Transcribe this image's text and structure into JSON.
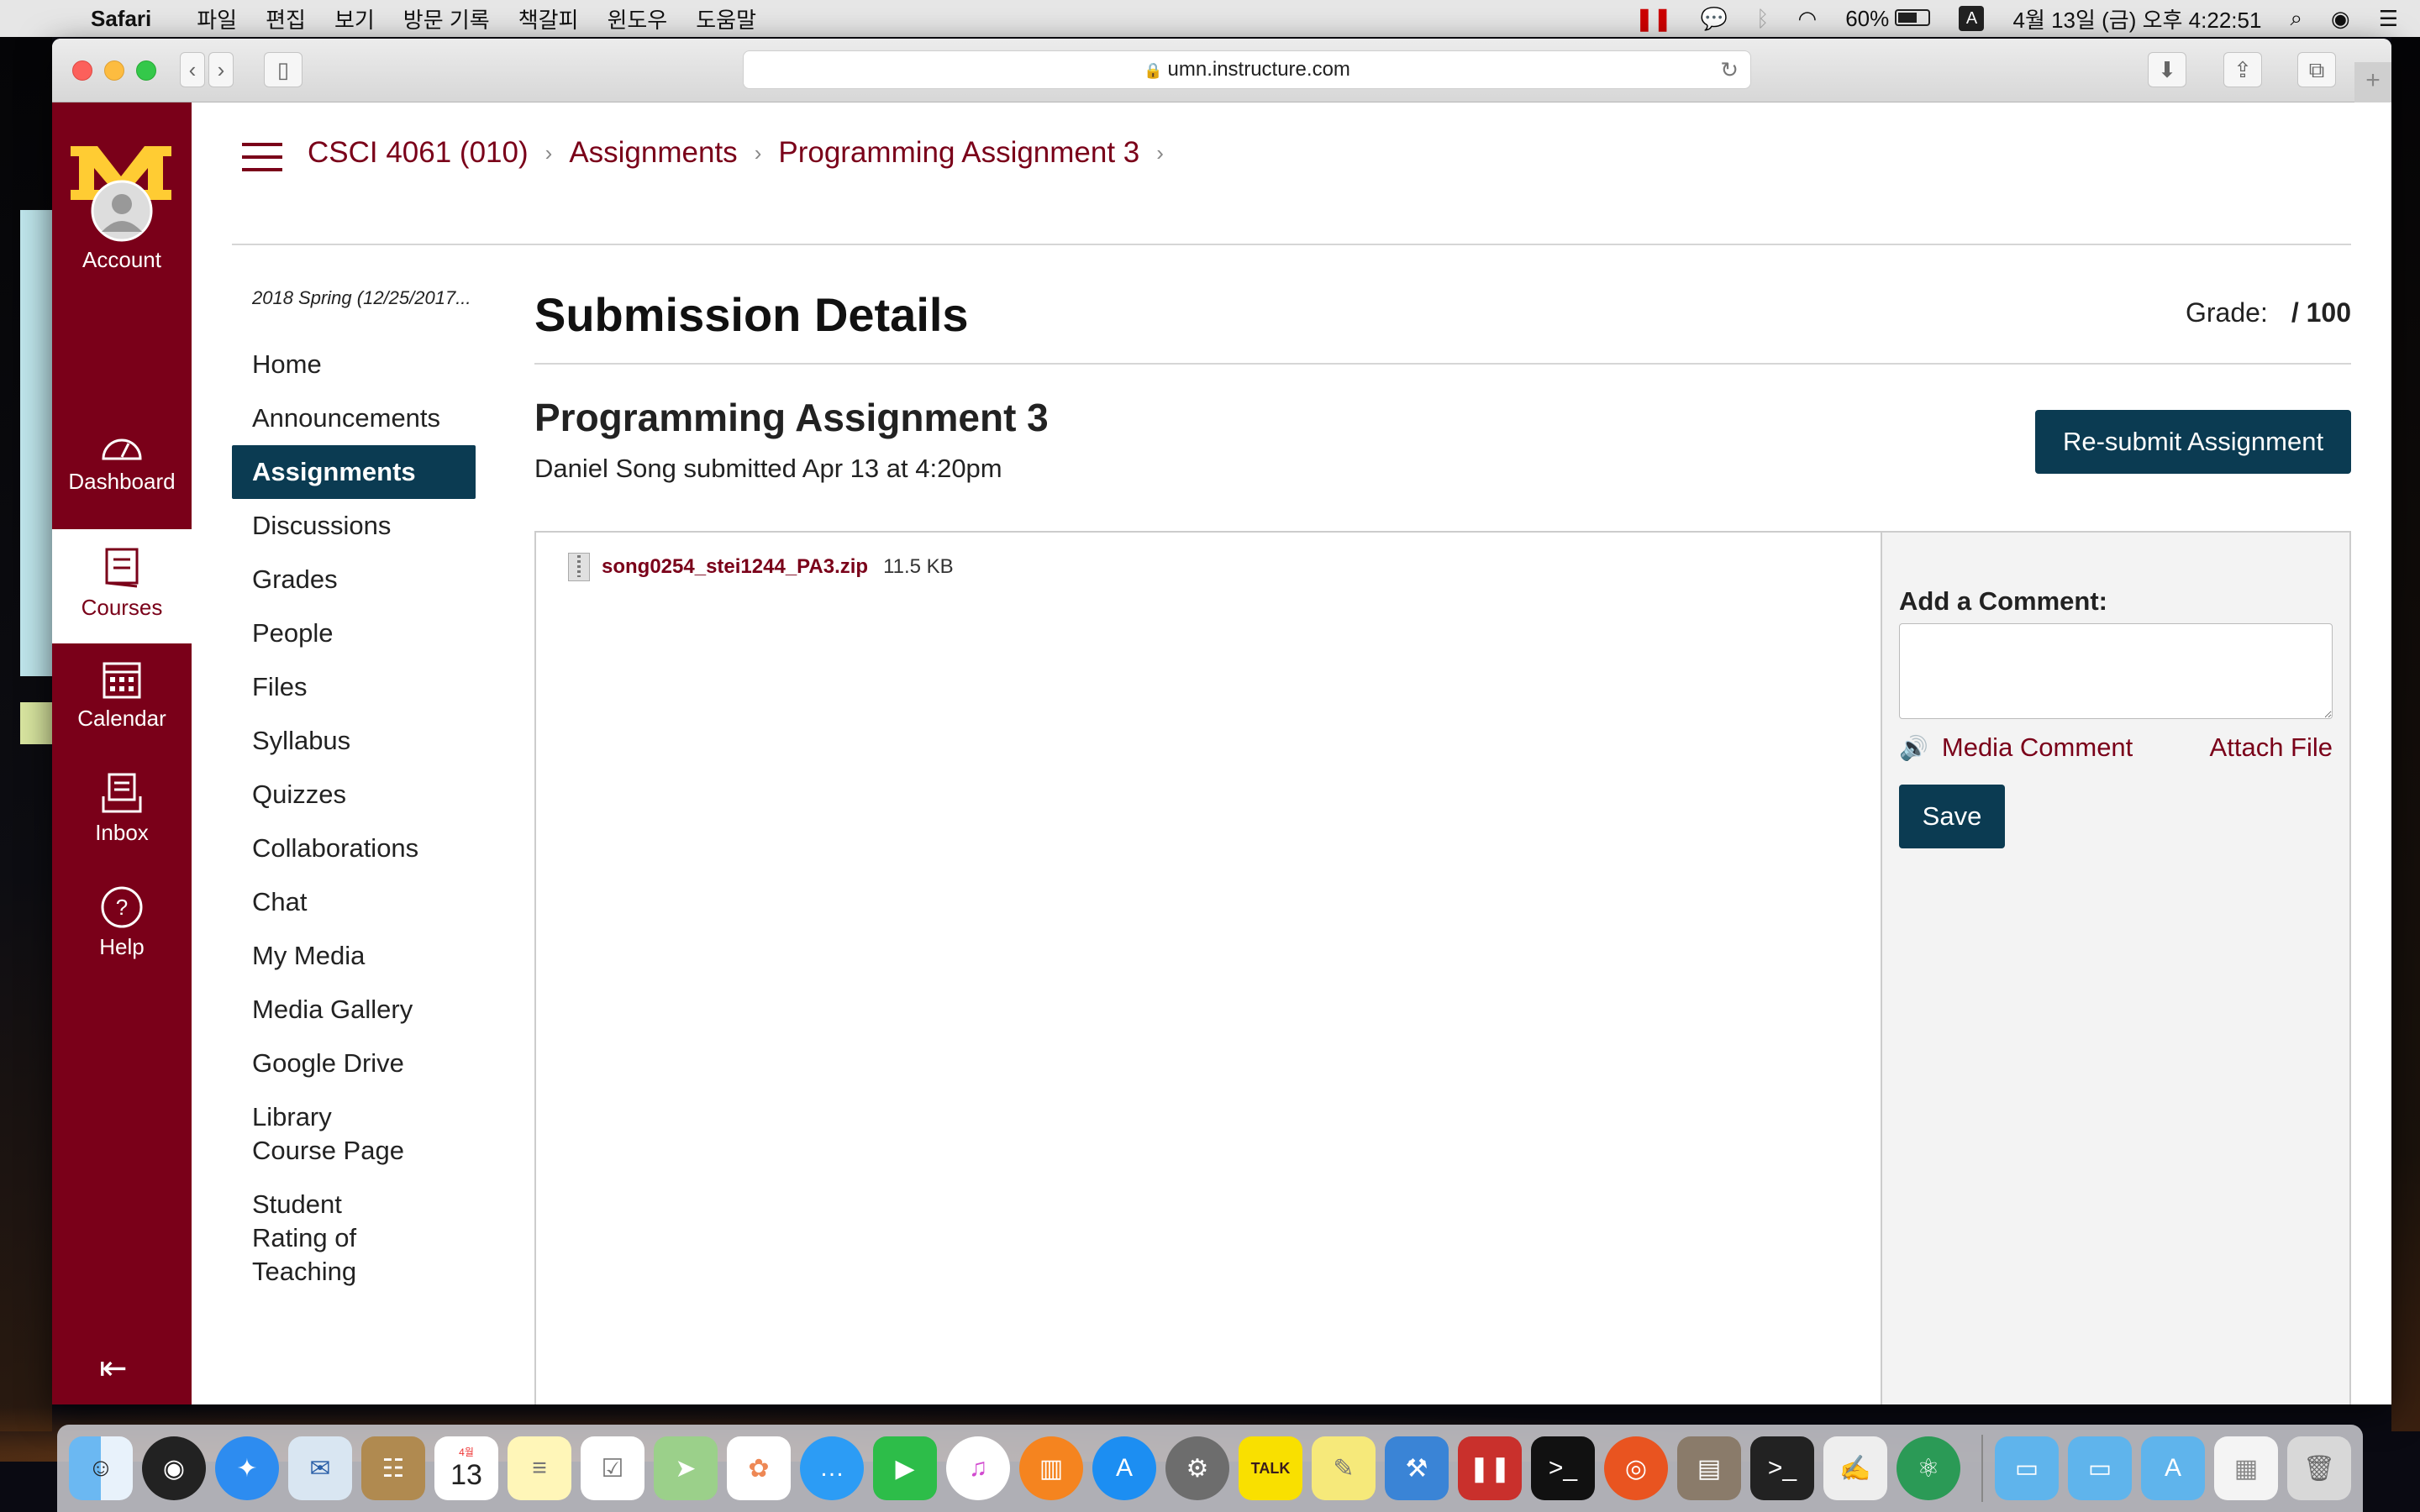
{
  "menubar": {
    "app_name": "Safari",
    "menus": [
      "파일",
      "편집",
      "보기",
      "방문 기록",
      "책갈피",
      "윈도우",
      "도움말"
    ],
    "battery": "60%",
    "input_source": "A",
    "datetime": "4월 13일 (금) 오후 4:22:51"
  },
  "browser": {
    "url": "umn.instructure.com"
  },
  "global_nav": {
    "items": [
      {
        "label": "Account"
      },
      {
        "label": "Dashboard"
      },
      {
        "label": "Courses"
      },
      {
        "label": "Calendar"
      },
      {
        "label": "Inbox"
      },
      {
        "label": "Help"
      }
    ]
  },
  "breadcrumb": {
    "course": "CSCI 4061 (010)",
    "section": "Assignments",
    "page": "Programming Assignment 3"
  },
  "course_nav": {
    "term": "2018 Spring (12/25/2017...",
    "items": [
      "Home",
      "Announcements",
      "Assignments",
      "Discussions",
      "Grades",
      "People",
      "Files",
      "Syllabus",
      "Quizzes",
      "Collaborations",
      "Chat",
      "My Media",
      "Media Gallery",
      "Google Drive",
      "Library Course Page",
      "Student Rating of Teaching"
    ],
    "active": "Assignments"
  },
  "main": {
    "title": "Submission Details",
    "grade_label": "Grade:",
    "grade_value": "/ 100",
    "assignment_title": "Programming Assignment 3",
    "submitted_by": "Daniel Song submitted Apr 13 at 4:20pm",
    "resubmit_label": "Re-submit Assignment",
    "file_name": "song0254_stei1244_PA3.zip",
    "file_size": "11.5 KB"
  },
  "comments": {
    "label": "Add a Comment:",
    "text_value": "",
    "media_comment": "Media Comment",
    "attach_file": "Attach File",
    "save_label": "Save"
  },
  "colors": {
    "brand_maroon": "#7a0019",
    "brand_gold": "#ffcc33",
    "button_navy": "#0b3b52"
  },
  "dock": {
    "apps": [
      "Finder",
      "Siri",
      "Safari",
      "Mail",
      "Contacts",
      "Calendar",
      "Notes",
      "Reminders",
      "Maps",
      "Photos",
      "Messages",
      "FaceTime",
      "iTunes",
      "iBooks",
      "App Store",
      "System Preferences",
      "KakaoTalk",
      "Stickies",
      "Xcode",
      "Parallels",
      "Terminal",
      "Ubuntu",
      "Archive Utility",
      "Terminal 2",
      "TextEdit",
      "Atom",
      "Folder 1",
      "Folder 2",
      "Applications",
      "Preview",
      "Trash"
    ],
    "calendar_month": "4월",
    "calendar_day": "13"
  }
}
